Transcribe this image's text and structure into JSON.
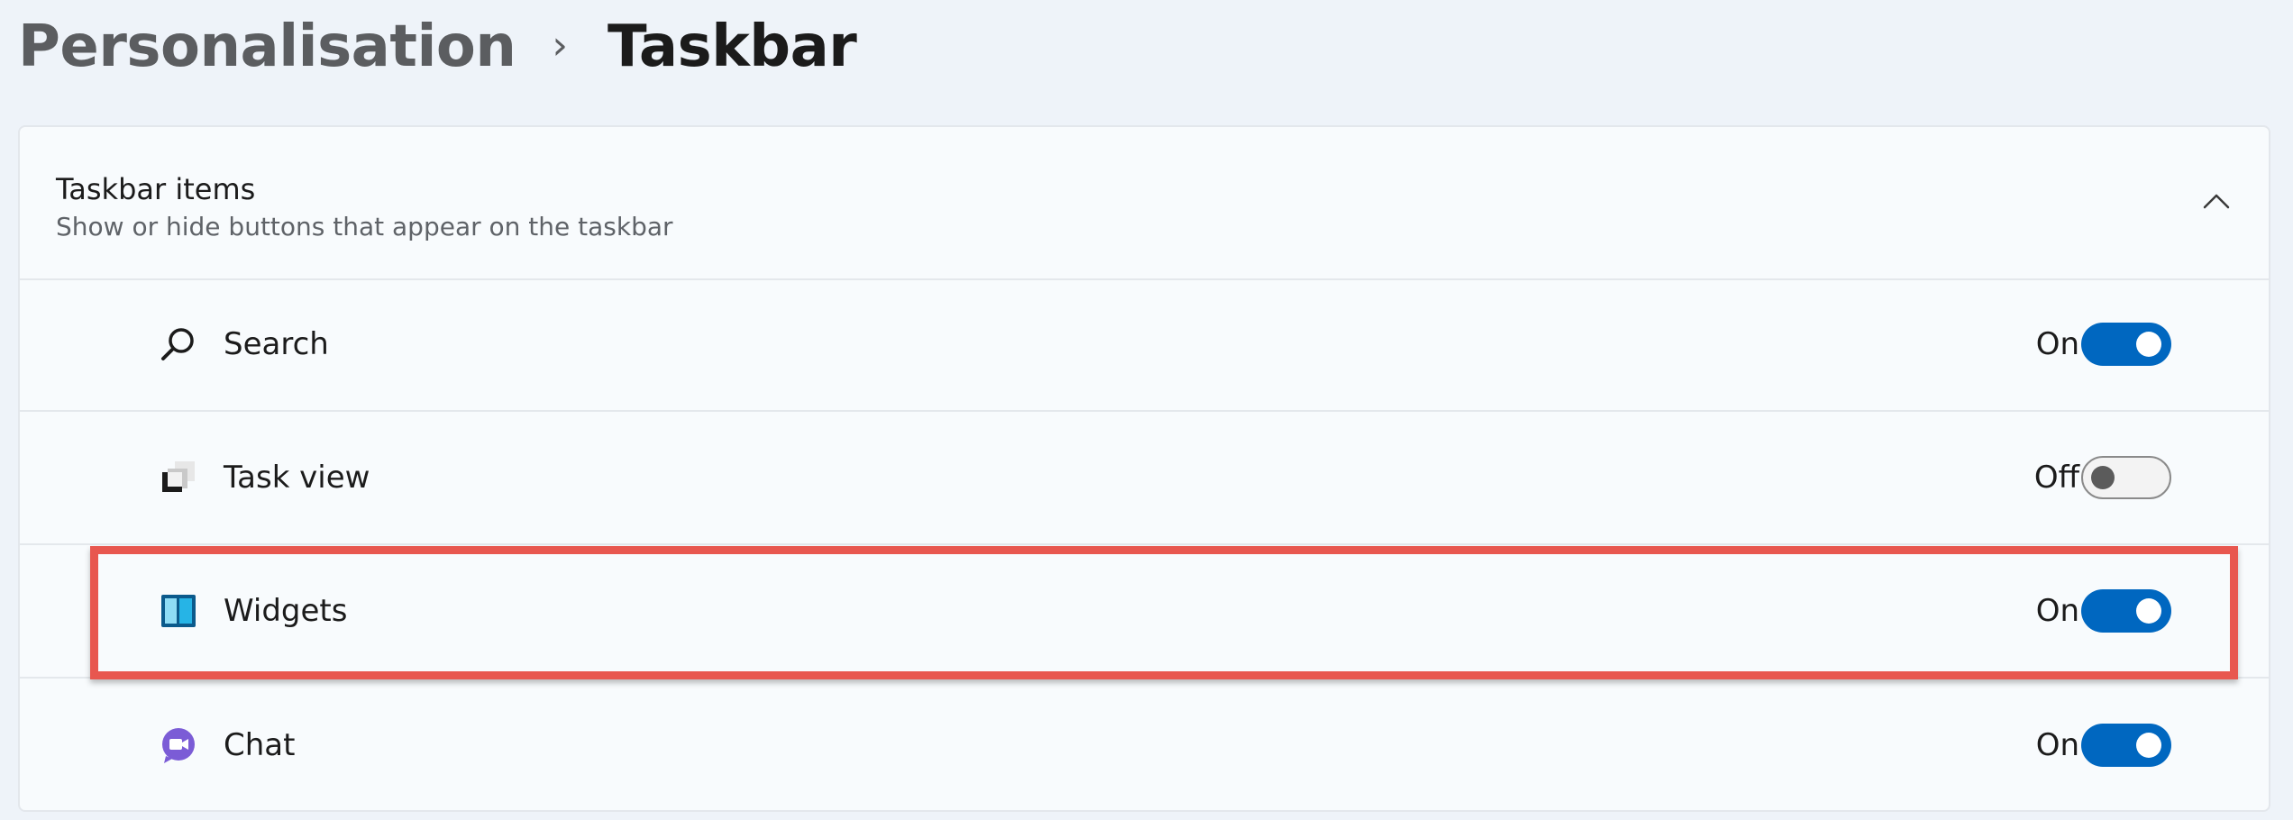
{
  "breadcrumb": {
    "parent": "Personalisation",
    "separator": "›",
    "current": "Taskbar"
  },
  "section": {
    "title": "Taskbar items",
    "subtitle": "Show or hide buttons that appear on the taskbar",
    "expanded": true,
    "collapse_icon": "chevron-up-icon"
  },
  "items": [
    {
      "label": "Search",
      "icon": "search-icon",
      "state_text": "On",
      "on": true
    },
    {
      "label": "Task view",
      "icon": "task-view-icon",
      "state_text": "Off",
      "on": false
    },
    {
      "label": "Widgets",
      "icon": "widgets-icon",
      "state_text": "On",
      "on": true
    },
    {
      "label": "Chat",
      "icon": "chat-icon",
      "state_text": "On",
      "on": true
    }
  ],
  "highlighted_item": "Widgets",
  "colors": {
    "accent": "#0067c0",
    "highlight_border": "#e8574f",
    "background": "#eef3f9"
  }
}
